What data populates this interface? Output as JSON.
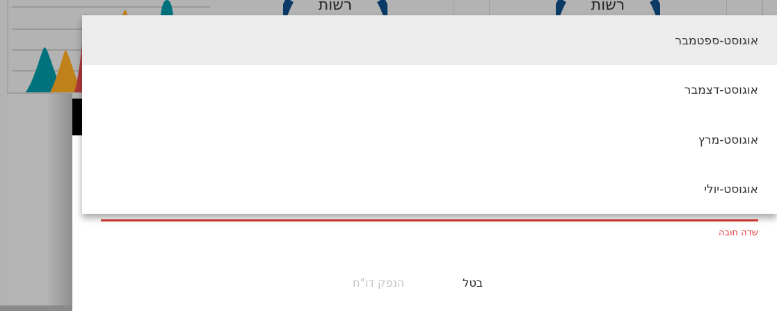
{
  "background": {
    "gauges": [
      {
        "label": "רשות"
      },
      {
        "label": "רשות"
      }
    ]
  },
  "dialog": {
    "menu": {
      "items": [
        {
          "label": "אוגוסט-ספטמבר",
          "selected": true
        },
        {
          "label": "אוגוסט-דצמבר",
          "selected": false
        },
        {
          "label": "אוגוסט-מרץ",
          "selected": false
        },
        {
          "label": "אוגוסט-יולי",
          "selected": false
        }
      ]
    },
    "field": {
      "invalid": true,
      "error": "שדה חובה"
    },
    "buttons": [
      {
        "label": "בטל",
        "disabled": false
      },
      {
        "label": "הנפק דו\"ח",
        "disabled": true
      }
    ]
  }
}
